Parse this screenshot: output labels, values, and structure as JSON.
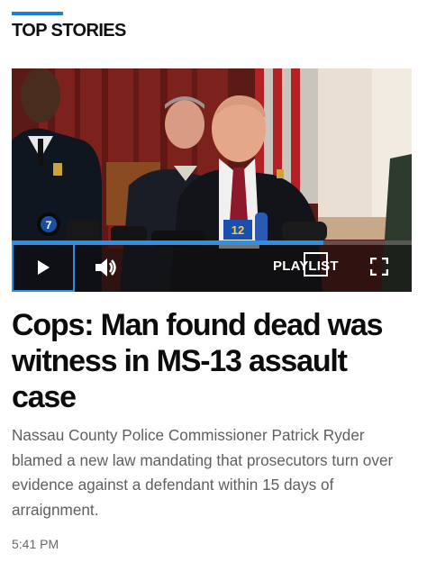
{
  "section": {
    "title": "TOP STORIES",
    "accent_color": "#1b7fd6"
  },
  "video": {
    "progress_percent": 78,
    "controls": {
      "play_icon": "play-icon",
      "volume_icon": "volume-icon",
      "playlist_label": "PLAYLIST",
      "fullscreen_icon": "fullscreen-icon"
    },
    "mic_flag_numbers": [
      "7",
      "12"
    ],
    "accent_color": "#2e8fe6"
  },
  "article": {
    "headline": "Cops: Man found dead was witness in MS-13 assault case",
    "summary": "Nassau County Police Commissioner Patrick Ryder blamed a new law mandating that prosecutors turn over evidence against a defendant within 15 days of arraignment.",
    "time": "5:41 PM"
  }
}
